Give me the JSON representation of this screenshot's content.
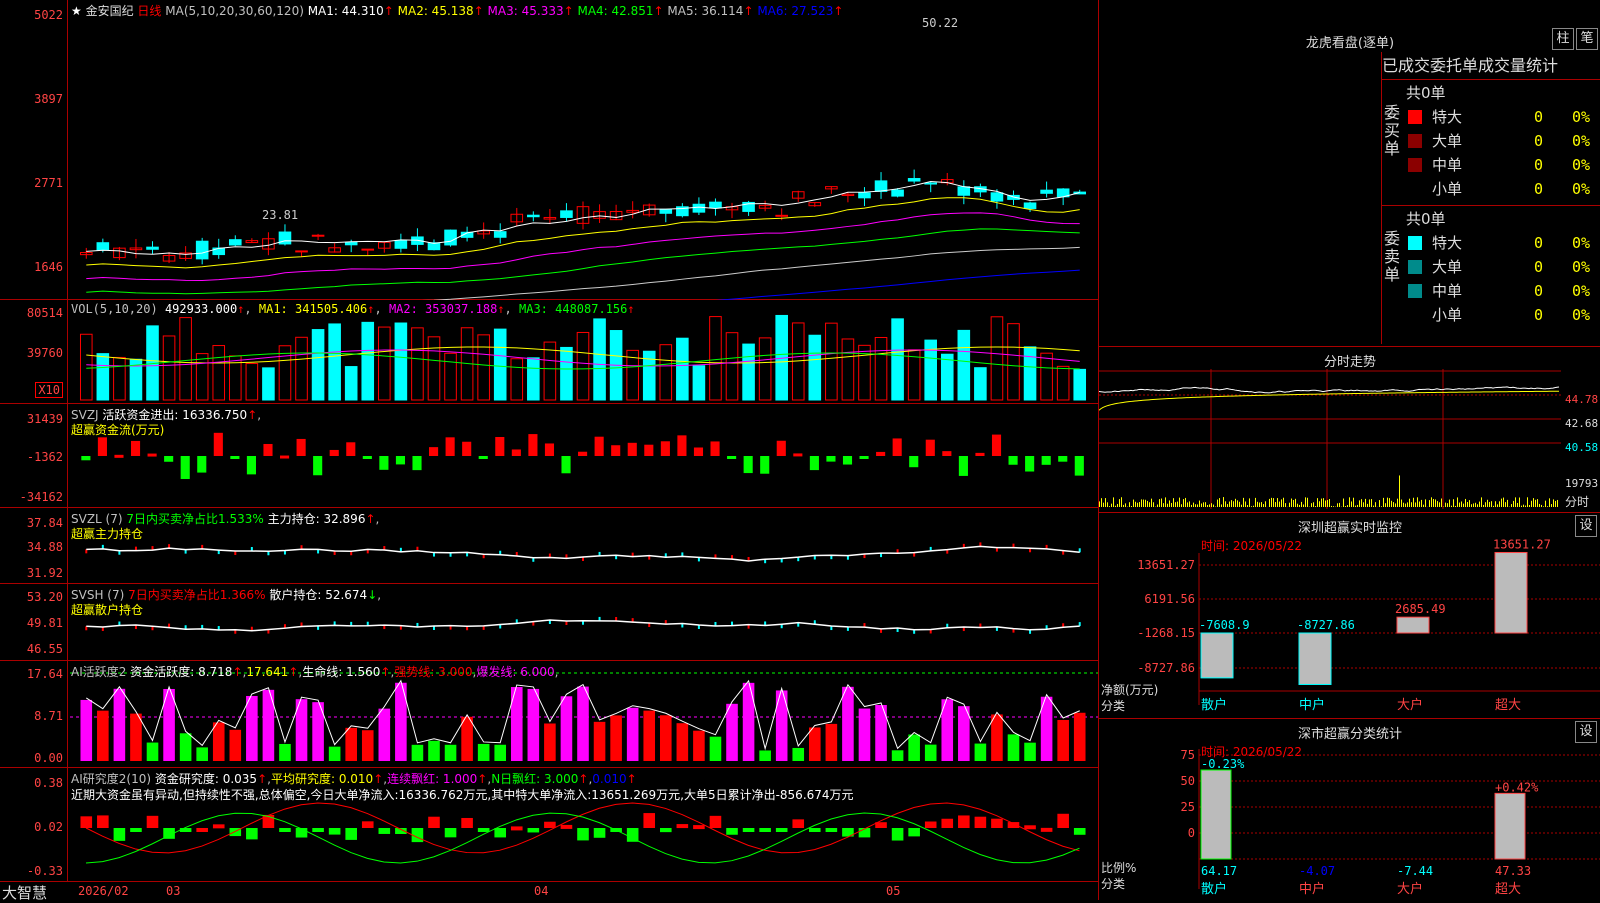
{
  "stock": {
    "name": "金安国纪",
    "period": "日线"
  },
  "price": {
    "ticks": [
      "5022",
      "3897",
      "2771",
      "1646"
    ],
    "ma_header": "MA(5,10,20,30,60,120)",
    "ma": [
      {
        "label": "MA1: 44.310",
        "color": "#ffffff"
      },
      {
        "label": "MA2: 45.138",
        "color": "#ffff00"
      },
      {
        "label": "MA3: 45.333",
        "color": "#ff00ff"
      },
      {
        "label": "MA4: 42.851",
        "color": "#00ff00"
      },
      {
        "label": "MA5: 36.114",
        "color": "#c0c0c0"
      },
      {
        "label": "MA6: 27.523",
        "color": "#0000ff"
      }
    ],
    "high_label": "50.22",
    "low_label": "23.81"
  },
  "vol": {
    "ticks": [
      "80514",
      "39760"
    ],
    "unit": "X10",
    "header": "VOL(5,10,20)",
    "value": "492933.000",
    "ma1": "MA1: 341505.406",
    "ma2": "MA2: 353037.188",
    "ma3": "MA3: 448087.156"
  },
  "svzj": {
    "ticks": [
      "31439",
      "-1362",
      "-34162"
    ],
    "header": "SVZJ",
    "label": "活跃资金进出: 16336.750",
    "sub": "超赢资金流(万元)"
  },
  "svzl": {
    "ticks": [
      "37.84",
      "34.88",
      "31.92"
    ],
    "header": "SVZL (7)",
    "ratio": "7日内买卖净占比1.533%",
    "label": "主力持仓: 32.896",
    "sub": "超赢主力持仓"
  },
  "svsh": {
    "ticks": [
      "53.20",
      "49.81",
      "46.55"
    ],
    "header": "SVSH (7)",
    "ratio": "7日内买卖净占比1.366%",
    "label": "散户持仓: 52.674",
    "sub": "超赢散户持仓"
  },
  "ai2": {
    "ticks": [
      "17.64",
      "8.71",
      "0.00"
    ],
    "header": "AI活跃度2",
    "a": "资金活跃度: 8.718",
    "b": "17.641",
    "c": "生命线: 1.560",
    "d": "强势线: 3.000",
    "e": "爆发线: 6.000"
  },
  "ai_res": {
    "ticks": [
      "0.38",
      "0.02",
      "-0.33"
    ],
    "header": "AI研究度2(10)",
    "a": "资金研究度: 0.035",
    "b": "平均研究度: 0.010",
    "c": "连续飘红: 1.000",
    "d": "N日飘红: 3.000",
    "e": "0.010",
    "comment": "近期大资金虽有异动,但持续性不强,总体偏空,今日大单净流入:16336.762万元,其中特大单净流入:13651.269万元,大单5日累计净出-856.674万元"
  },
  "timeline": {
    "brand": "大智慧",
    "labels": [
      "2026/02",
      "03",
      "04",
      "05"
    ]
  },
  "lhb": {
    "title": "龙虎看盘(逐单)",
    "btn1": "柱",
    "btn2": "笔",
    "tabs": "已成交委托单成交量统计",
    "buy": {
      "side": "委买单",
      "total": "共0单",
      "rows": [
        {
          "n": "特大",
          "v": "0",
          "p": "0%",
          "c": "#ff0000"
        },
        {
          "n": "大单",
          "v": "0",
          "p": "0%",
          "c": "#8b0000"
        },
        {
          "n": "中单",
          "v": "0",
          "p": "0%",
          "c": "#8b0000"
        },
        {
          "n": "小单",
          "v": "0",
          "p": "0%",
          "c": ""
        }
      ]
    },
    "sell": {
      "side": "委卖单",
      "total": "共0单",
      "rows": [
        {
          "n": "特大",
          "v": "0",
          "p": "0%",
          "c": "#00ffff"
        },
        {
          "n": "大单",
          "v": "0",
          "p": "0%",
          "c": "#008b8b"
        },
        {
          "n": "中单",
          "v": "0",
          "p": "0%",
          "c": "#008b8b"
        },
        {
          "n": "小单",
          "v": "0",
          "p": "0%",
          "c": ""
        }
      ]
    }
  },
  "fenshi": {
    "title": "分时走势",
    "ticks": [
      "44.78",
      "42.68",
      "40.58"
    ],
    "vol": "19793",
    "unit": "分时"
  },
  "monitor": {
    "title": "深圳超赢实时监控",
    "btn": "设",
    "time": "时间: 2026/05/22",
    "ylabel": "净额(万元)",
    "xlabel": "分类",
    "ticks": [
      "13651.27",
      "6191.56",
      "-1268.15",
      "-8727.86"
    ],
    "cats": [
      "散户",
      "中户",
      "大户",
      "超大"
    ],
    "values": [
      "-7608.9",
      "-8727.86",
      "2685.49",
      "13651.27"
    ]
  },
  "classify": {
    "title": "深市超赢分类统计",
    "btn": "设",
    "time": "时间: 2026/05/22",
    "ylabel": "比例%",
    "xlabel": "分类",
    "ticks": [
      "75",
      "50",
      "25",
      "0"
    ],
    "cats": [
      "散户",
      "中户",
      "大户",
      "超大"
    ],
    "top": [
      "-0.23%",
      "",
      "",
      "+0.42%"
    ],
    "bottom": [
      "64.17",
      "-4.07",
      "-7.44",
      "47.33"
    ]
  },
  "chart_data": [
    {
      "type": "bar",
      "title": "深圳超赢实时监控",
      "ylabel": "净额(万元)",
      "xlabel": "分类",
      "categories": [
        "散户",
        "中户",
        "大户",
        "超大"
      ],
      "values": [
        -7608.9,
        -8727.86,
        2685.49,
        13651.27
      ],
      "ylim": [
        -8727.86,
        13651.27
      ]
    },
    {
      "type": "bar",
      "title": "深市超赢分类统计",
      "ylabel": "比例%",
      "xlabel": "分类",
      "categories": [
        "散户",
        "中户",
        "大户",
        "超大"
      ],
      "values": [
        64.17,
        -4.07,
        -7.44,
        47.33
      ],
      "ylim": [
        0,
        75
      ]
    }
  ]
}
